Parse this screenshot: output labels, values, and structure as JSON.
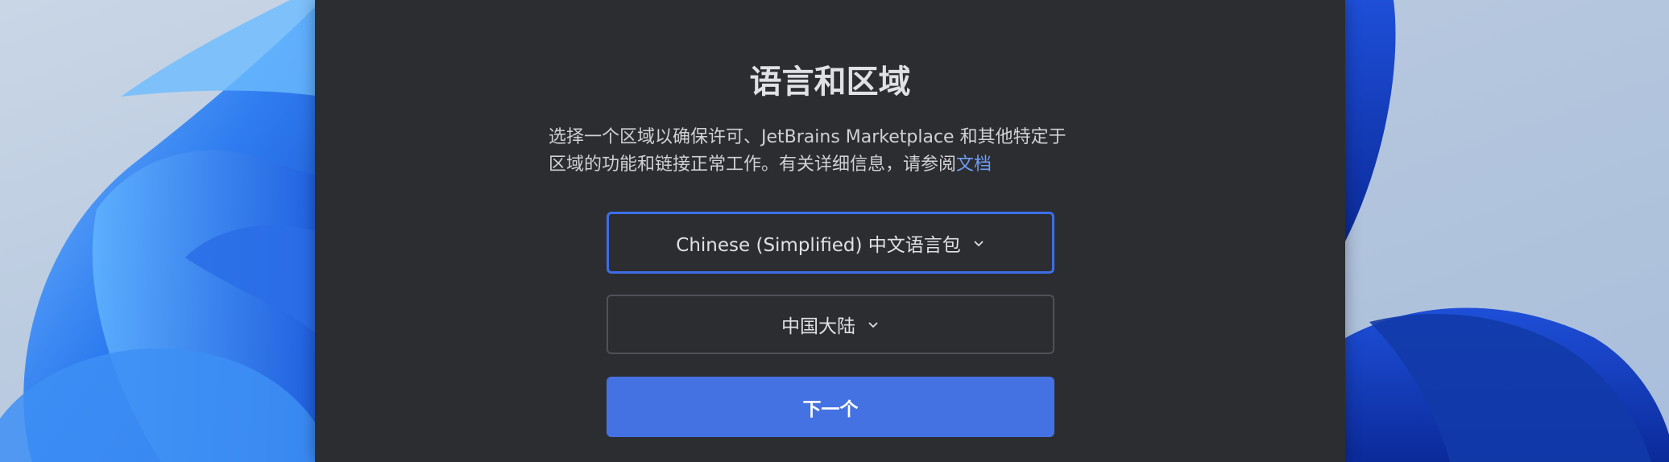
{
  "dialog": {
    "title": "语言和区域",
    "description_line1": "选择一个区域以确保许可、JetBrains Marketplace 和其他特定于",
    "description_line2": "区域的功能和链接正常工作。有关详细信息，请参阅",
    "description_link": "文档",
    "language_select": {
      "value": "Chinese (Simplified) 中文语言包",
      "icon": "chevron-down-icon"
    },
    "region_select": {
      "value": "中国大陆",
      "icon": "chevron-down-icon"
    },
    "next_button": "下一个"
  },
  "colors": {
    "dialog_bg": "#2b2d30",
    "accent": "#4572e3",
    "focus_border": "#3d6ee8",
    "link": "#6f9cf5"
  }
}
